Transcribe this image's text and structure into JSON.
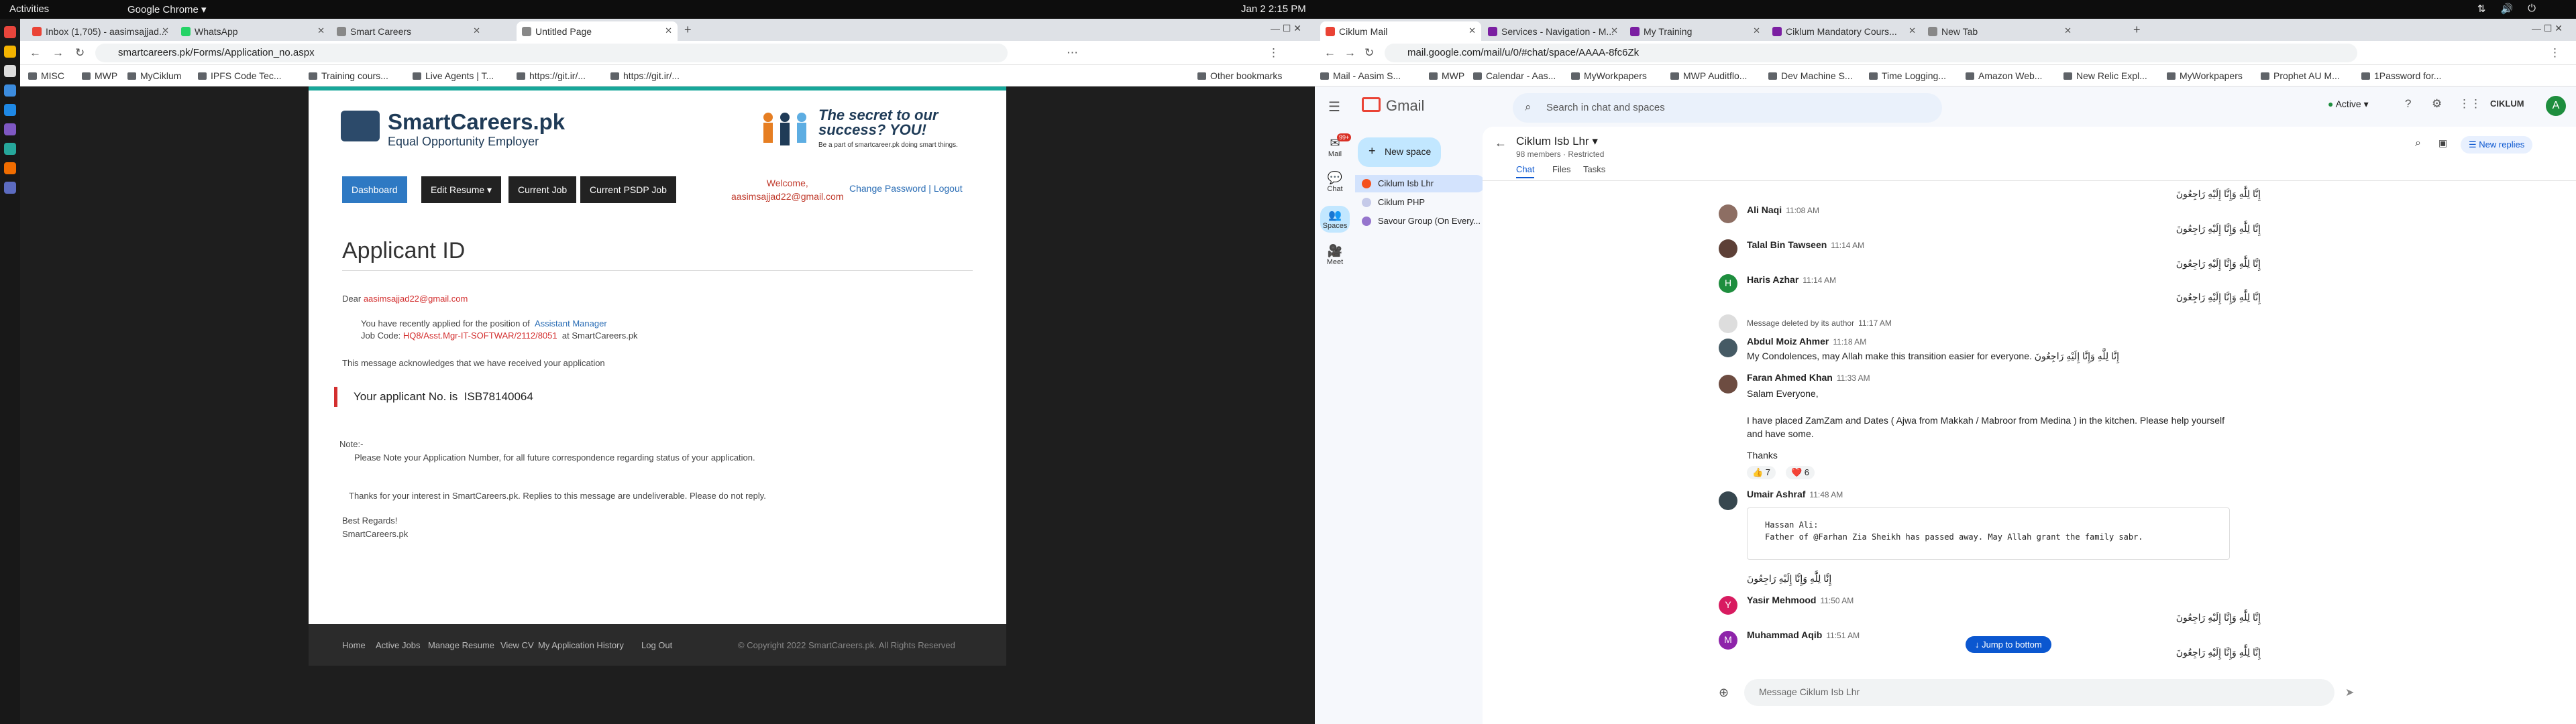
{
  "topbar": {
    "activities": "Activities",
    "app": "Google Chrome ▾",
    "clock": "Jan 2  2:15 PM"
  },
  "left_window": {
    "tabs": [
      {
        "label": "Inbox (1,705) - aasimsajjad..."
      },
      {
        "label": "WhatsApp"
      },
      {
        "label": "Smart Careers"
      },
      {
        "label": "Untitled Page"
      }
    ],
    "url": "smartcareers.pk/Forms/Application_no.aspx",
    "bookmarks": [
      "MISC",
      "MWP",
      "MyCiklum",
      "IPFS Code Tec...",
      "Training cours...",
      "Live Agents | T...",
      "https://git.ir/...",
      "https://git.ir/..."
    ],
    "other_bookmarks": "Other bookmarks"
  },
  "smartcareers": {
    "logo_title": "SmartCareers.pk",
    "logo_sub": "Equal Opportunity Employer",
    "slogan": "The secret to our success? YOU!",
    "slogan_sub": "Be a part of smartcareer.pk doing smart things.",
    "nav": [
      "Dashboard",
      "Edit Resume ▾",
      "Current Job",
      "Current PSDP Job"
    ],
    "welcome": "Welcome,",
    "welcome_email": "aasimsajjad22@gmail.com",
    "change_password": "Change Password | Logout",
    "page_title": "Applicant ID",
    "dear": "Dear",
    "dear_email": "aasimsajjad22@gmail.com",
    "applied_text": "You have recently applied for the position of",
    "position": "Assistant Manager",
    "job_code_label": "Job Code:",
    "job_code": "HQ8/Asst.Mgr-IT-SOFTWAR/2112/8051",
    "at_text": "at SmartCareers.pk",
    "ack": "This message acknowledges that we have received your application",
    "app_no_label": "Your applicant No. is",
    "app_no": "ISB78140064",
    "note": "Note:-",
    "note_text": "Please Note your Application Number, for all future correspondence regarding status of your application.",
    "thanks": "Thanks for your interest in SmartCareers.pk. Replies to this message are undeliverable. Please do not reply.",
    "regards": "Best Regards!",
    "regards_sig": "SmartCareers.pk",
    "footer_links": [
      "Home",
      "Active Jobs",
      "Manage Resume",
      "View CV",
      "My Application History",
      "Log Out"
    ],
    "copyright": "© Copyright 2022 SmartCareers.pk. All Rights Reserved"
  },
  "right_window": {
    "tabs": [
      {
        "label": "Ciklum Mail"
      },
      {
        "label": "Services - Navigation - M..."
      },
      {
        "label": "My Training"
      },
      {
        "label": "Ciklum Mandatory Cours..."
      },
      {
        "label": "New Tab"
      }
    ],
    "url": "mail.google.com/mail/u/0/#chat/space/AAAA-8fc6Zk",
    "bookmarks": [
      "Mail - Aasim S...",
      "MWP",
      "Calendar - Aas...",
      "MyWorkpapers",
      "MWP Auditflo...",
      "Dev Machine S...",
      "Time Logging...",
      "Amazon Web...",
      "New Relic Expl...",
      "MyWorkpapers",
      "Prophet AU M...",
      "1Password for..."
    ]
  },
  "gmail": {
    "logo": "Gmail",
    "search_placeholder": "Search in chat and spaces",
    "status": "Active",
    "brand": "CIKLUM",
    "avatar": "A",
    "rail": [
      {
        "label": "Mail",
        "badge": "99+"
      },
      {
        "label": "Chat"
      },
      {
        "label": "Spaces"
      },
      {
        "label": "Meet"
      }
    ],
    "new_space": "New space",
    "spaces": [
      "Ciklum Isb Lhr",
      "Ciklum PHP",
      "Savour Group (On Every..."
    ],
    "space_title": "Ciklum Isb Lhr",
    "space_meta": "98 members · Restricted",
    "space_tabs": [
      "Chat",
      "Files",
      "Tasks"
    ],
    "new_replies": "New replies",
    "inna": "إِنَّا لِلَّٰهِ وَإِنَّا إِلَيْهِ رَاجِعُونَ",
    "messages": [
      {
        "name": "Ali Naqi",
        "time": "11:08 AM"
      },
      {
        "name": "Talal Bin Tawseen",
        "time": "11:14 AM"
      },
      {
        "name": "Haris Azhar",
        "time": "11:14 AM"
      },
      {
        "deleted": "Message deleted by its author",
        "time": "11:17 AM"
      },
      {
        "name": "Abdul Moiz Ahmer",
        "time": "11:18 AM",
        "text": "My Condolences, may Allah make this transition easier for everyone."
      },
      {
        "name": "Faran Ahmed Khan",
        "time": "11:33 AM",
        "line1": "Salam Everyone,",
        "line2": "I have placed ZamZam and Dates ( Ajwa from Makkah / Mabroor from Medina ) in the kitchen. Please help yourself and have some.",
        "line3": "Thanks",
        "r1": "👍 7",
        "r2": "❤️ 6"
      },
      {
        "name": "Umair Ashraf",
        "time": "11:48 AM",
        "quote_name": "Hassan Ali:",
        "quote_text": "Father of @Farhan Zia Sheikh has passed away. May Allah grant the family sabr."
      },
      {
        "name": "Yasir Mehmood",
        "time": "11:50 AM"
      },
      {
        "name": "Muhammad Aqib",
        "time": "11:51 AM"
      }
    ],
    "jump": "Jump to bottom",
    "compose_placeholder": "Message Ciklum Isb Lhr"
  }
}
